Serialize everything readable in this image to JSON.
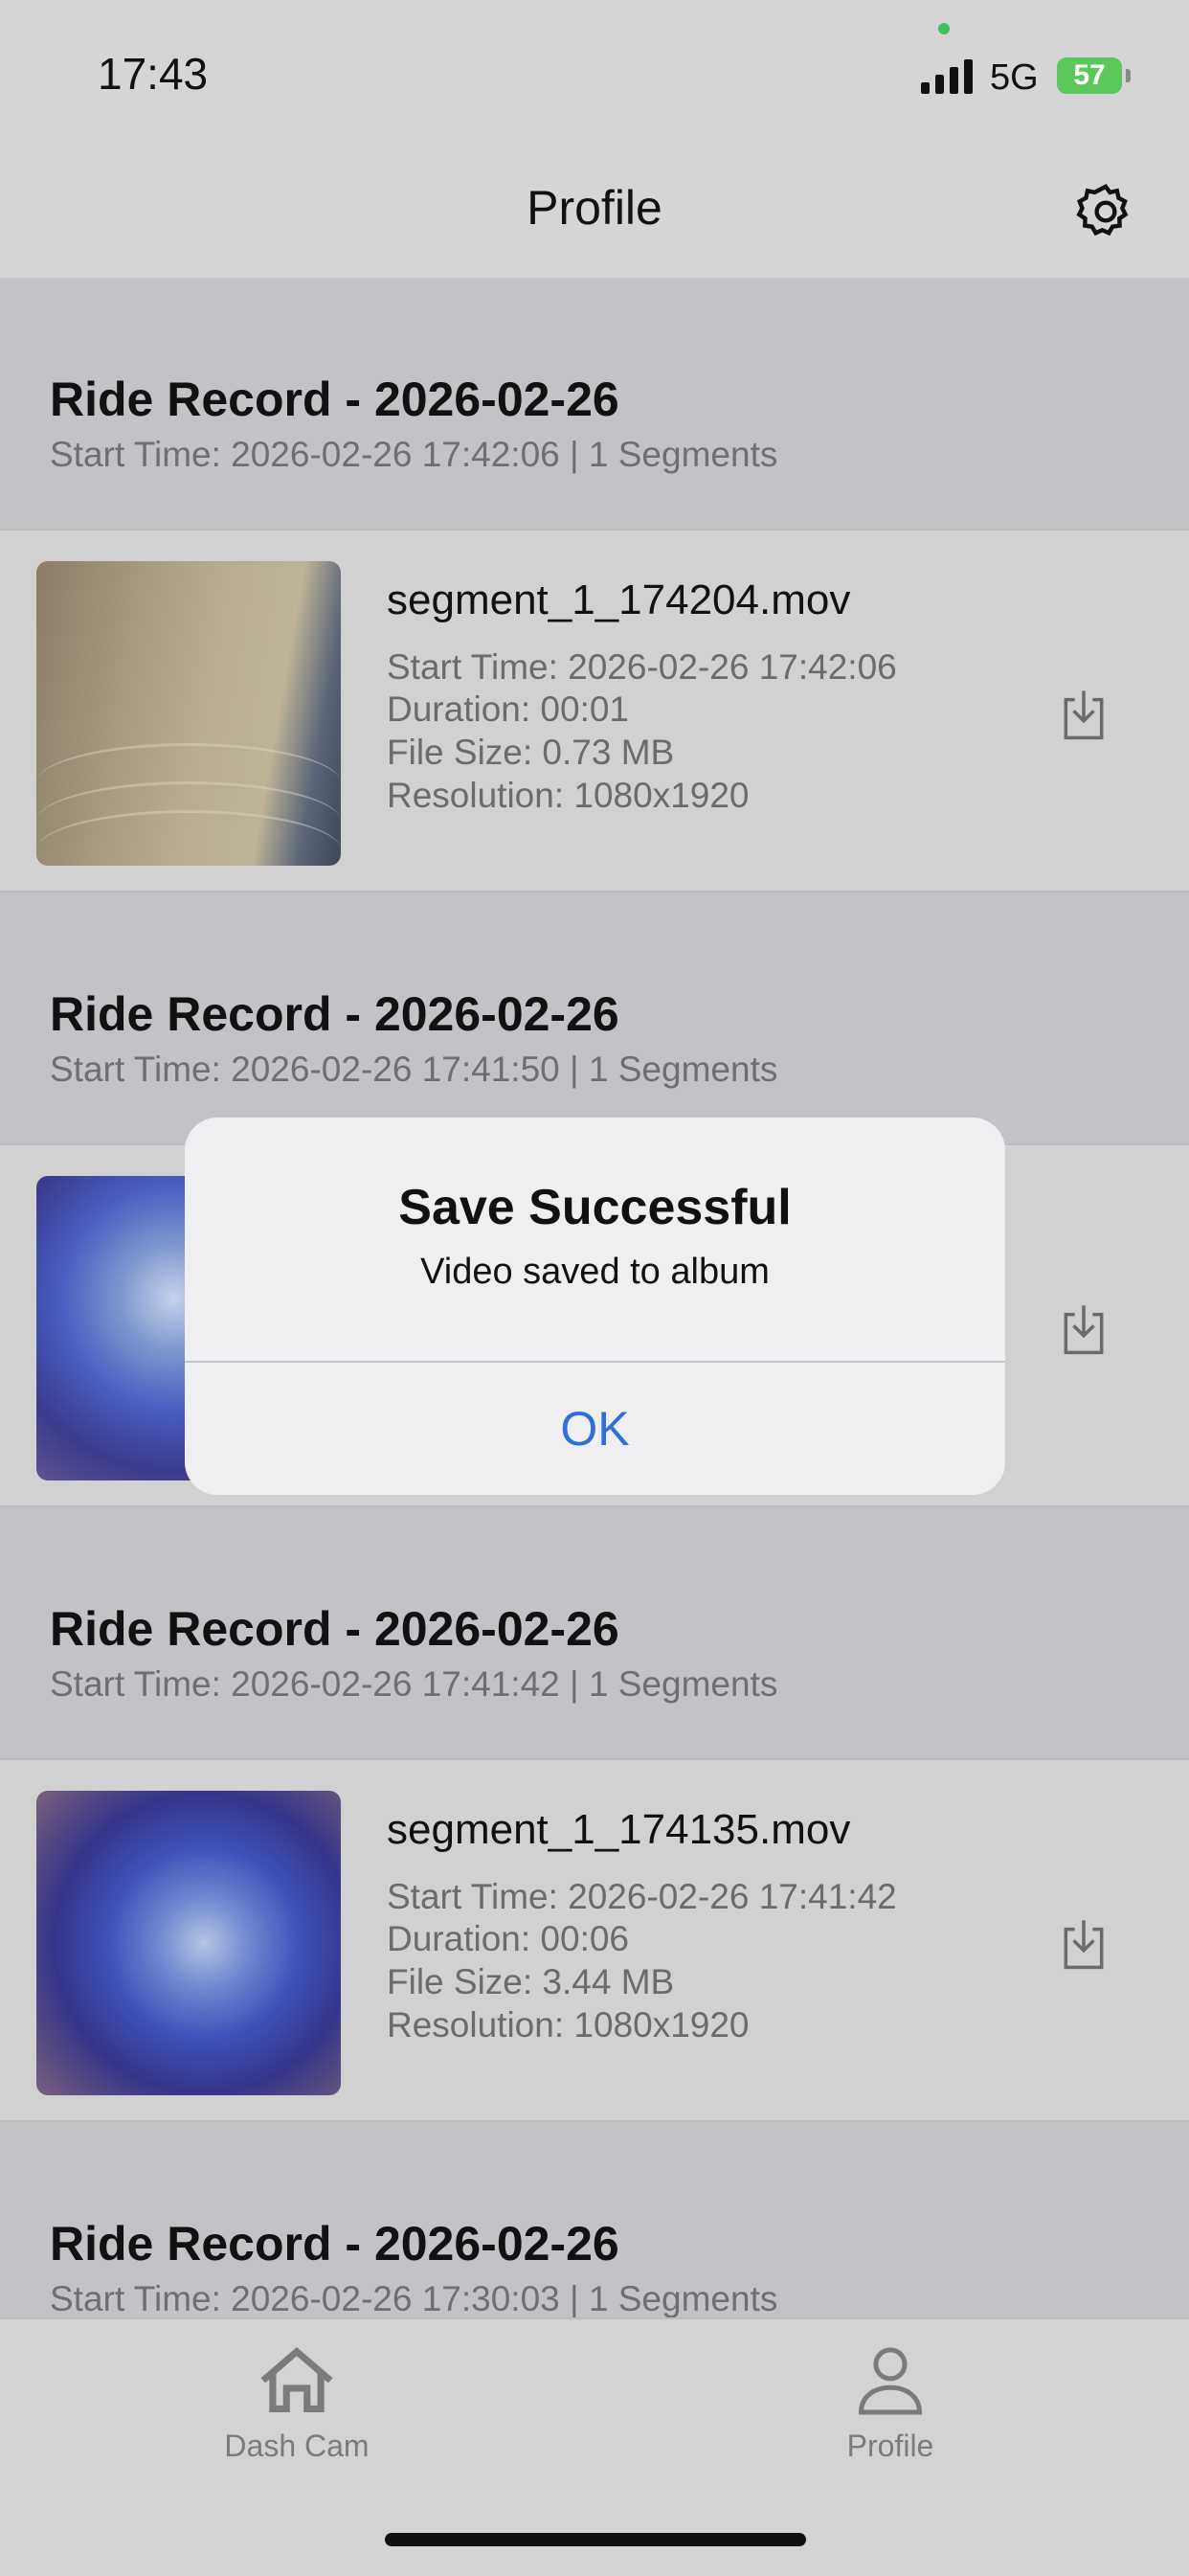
{
  "status_bar": {
    "time": "17:43",
    "network": "5G",
    "battery": "57"
  },
  "nav": {
    "title": "Profile",
    "settings_icon": "gear-icon"
  },
  "records": [
    {
      "title": "Ride Record - 2026-02-26",
      "subtitle": "Start Time: 2026-02-26 17:42:06 | 1 Segments",
      "segment": {
        "name": "segment_1_174204.mov",
        "start": "Start Time: 2026-02-26 17:42:06",
        "duration": "Duration: 00:01",
        "size": "File Size: 0.73 MB",
        "resolution": "Resolution: 1080x1920"
      }
    },
    {
      "title": "Ride Record - 2026-02-26",
      "subtitle": "Start Time: 2026-02-26 17:41:50 | 1 Segments"
    },
    {
      "title": "Ride Record - 2026-02-26",
      "subtitle": "Start Time: 2026-02-26 17:41:42 | 1 Segments",
      "segment": {
        "name": "segment_1_174135.mov",
        "start": "Start Time: 2026-02-26 17:41:42",
        "duration": "Duration: 00:06",
        "size": "File Size: 3.44 MB",
        "resolution": "Resolution: 1080x1920"
      }
    },
    {
      "title": "Ride Record - 2026-02-26",
      "subtitle": "Start Time: 2026-02-26 17:30:03 | 1 Segments"
    }
  ],
  "alert": {
    "title": "Save Successful",
    "message": "Video saved to album",
    "ok_label": "OK"
  },
  "tabs": [
    {
      "label": "Dash Cam",
      "icon": "house-icon"
    },
    {
      "label": "Profile",
      "icon": "person-icon"
    }
  ],
  "colors": {
    "accent": "#2f6fd8",
    "battery": "#5ac85a",
    "status_dot": "#3fc35a"
  }
}
